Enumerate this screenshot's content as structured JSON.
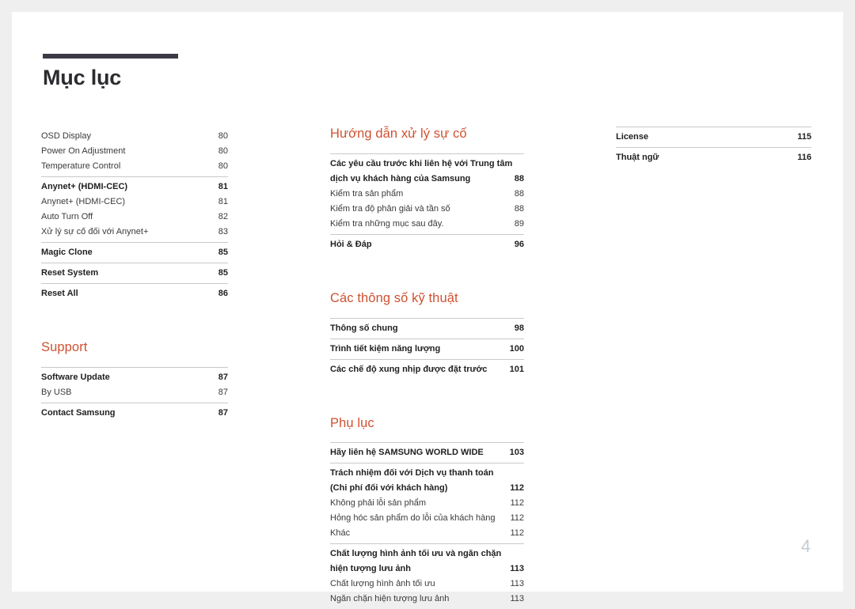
{
  "document": {
    "title": "Mục lục",
    "page_number": "4",
    "accent_color": "#cf5130",
    "title_rule_color": "#3c3b45",
    "page_number_color": "#c3ccd2"
  },
  "columns": [
    {
      "id": "column-1",
      "sections": [
        {
          "heading": null,
          "groups": [
            {
              "rule": false,
              "entries": [
                {
                  "label": "OSD Display",
                  "page": "80",
                  "major": false
                },
                {
                  "label": "Power On Adjustment",
                  "page": "80",
                  "major": false
                },
                {
                  "label": "Temperature Control",
                  "page": "80",
                  "major": false
                }
              ]
            },
            {
              "rule": true,
              "entries": [
                {
                  "label": "Anynet+ (HDMI-CEC)",
                  "page": "81",
                  "major": true
                },
                {
                  "label": "Anynet+ (HDMI-CEC)",
                  "page": "81",
                  "major": false
                },
                {
                  "label": "Auto Turn Off",
                  "page": "82",
                  "major": false
                },
                {
                  "label": "Xử lý sự cố đối với Anynet+",
                  "page": "83",
                  "major": false
                }
              ]
            },
            {
              "rule": true,
              "entries": [
                {
                  "label": "Magic Clone",
                  "page": "85",
                  "major": true
                }
              ]
            },
            {
              "rule": true,
              "entries": [
                {
                  "label": "Reset System",
                  "page": "85",
                  "major": true
                }
              ]
            },
            {
              "rule": true,
              "entries": [
                {
                  "label": "Reset All",
                  "page": "86",
                  "major": true
                }
              ]
            }
          ]
        },
        {
          "heading": "Support",
          "groups": [
            {
              "rule": true,
              "entries": [
                {
                  "label": "Software Update",
                  "page": "87",
                  "major": true
                },
                {
                  "label": "By USB",
                  "page": "87",
                  "major": false
                }
              ]
            },
            {
              "rule": true,
              "entries": [
                {
                  "label": "Contact Samsung",
                  "page": "87",
                  "major": true
                }
              ]
            }
          ]
        }
      ]
    },
    {
      "id": "column-2",
      "sections": [
        {
          "heading": "Hướng dẫn xử lý sự cố",
          "groups": [
            {
              "rule": true,
              "entries": [
                {
                  "label": "Các yêu cầu trước khi liên hệ với Trung tâm",
                  "page": "",
                  "major": true,
                  "continued": true
                },
                {
                  "label": "dịch vụ khách hàng của Samsung",
                  "page": "88",
                  "major": true
                },
                {
                  "label": "Kiểm tra sản phẩm",
                  "page": "88",
                  "major": false
                },
                {
                  "label": "Kiểm tra độ phân giải và tần số",
                  "page": "88",
                  "major": false
                },
                {
                  "label": "Kiểm tra những mục sau đây.",
                  "page": "89",
                  "major": false
                }
              ]
            },
            {
              "rule": true,
              "entries": [
                {
                  "label": "Hỏi & Đáp",
                  "page": "96",
                  "major": true
                }
              ]
            }
          ]
        },
        {
          "heading": "Các thông số kỹ thuật",
          "groups": [
            {
              "rule": true,
              "entries": [
                {
                  "label": "Thông số chung",
                  "page": "98",
                  "major": true
                }
              ]
            },
            {
              "rule": true,
              "entries": [
                {
                  "label": "Trình tiết kiệm năng lượng",
                  "page": "100",
                  "major": true
                }
              ]
            },
            {
              "rule": true,
              "entries": [
                {
                  "label": "Các chế độ xung nhịp được đặt trước",
                  "page": "101",
                  "major": true
                }
              ]
            }
          ]
        },
        {
          "heading": "Phụ lục",
          "groups": [
            {
              "rule": true,
              "entries": [
                {
                  "label": "Hãy liên hệ SAMSUNG WORLD WIDE",
                  "page": "103",
                  "major": true
                }
              ]
            },
            {
              "rule": true,
              "entries": [
                {
                  "label": "Trách nhiệm đối với Dịch vụ thanh toán",
                  "page": "",
                  "major": true,
                  "continued": true
                },
                {
                  "label": "(Chi phí đối với khách hàng)",
                  "page": "112",
                  "major": true
                },
                {
                  "label": "Không phải lỗi sản phẩm",
                  "page": "112",
                  "major": false
                },
                {
                  "label": "Hỏng hóc sản phẩm do lỗi của khách hàng",
                  "page": "112",
                  "major": false
                },
                {
                  "label": "Khác",
                  "page": "112",
                  "major": false
                }
              ]
            },
            {
              "rule": true,
              "entries": [
                {
                  "label": "Chất lượng hình ảnh tối ưu và ngăn chặn",
                  "page": "",
                  "major": true,
                  "continued": true
                },
                {
                  "label": "hiện tượng lưu ảnh",
                  "page": "113",
                  "major": true
                },
                {
                  "label": "Chất lượng hình ảnh tối ưu",
                  "page": "113",
                  "major": false
                },
                {
                  "label": "Ngăn chặn hiện tượng lưu ảnh",
                  "page": "113",
                  "major": false
                }
              ]
            }
          ]
        }
      ]
    },
    {
      "id": "column-3",
      "sections": [
        {
          "heading": null,
          "groups": [
            {
              "rule": true,
              "entries": [
                {
                  "label": "License",
                  "page": "115",
                  "major": true
                }
              ]
            },
            {
              "rule": true,
              "entries": [
                {
                  "label": "Thuật ngữ",
                  "page": "116",
                  "major": true
                }
              ]
            }
          ]
        }
      ]
    }
  ]
}
